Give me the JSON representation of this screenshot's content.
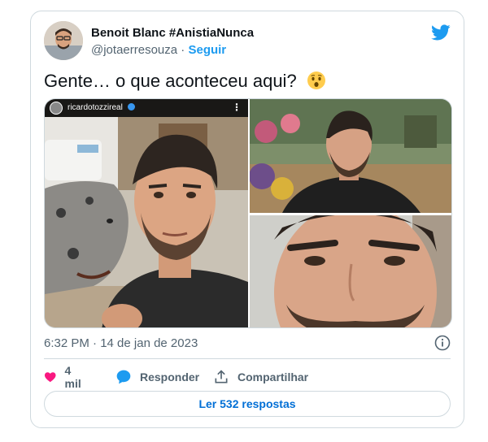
{
  "author": {
    "display_name": "Benoit Blanc #AnistiaNunca",
    "handle": "@jotaerresouza",
    "separator": "·",
    "follow_label": "Seguir"
  },
  "tweet": {
    "text": "Gente…  o que aconteceu aqui?",
    "emoji": "astonished-face-emoji",
    "timestamp": "6:32 PM · 14 de jan de 2023"
  },
  "media": {
    "instagram_username": "ricardotozzireal",
    "photos": [
      "selfie-with-dog",
      "man-in-garden",
      "face-closeup"
    ]
  },
  "actions": {
    "likes": "4 mil",
    "reply_label": "Responder",
    "share_label": "Compartilhar"
  },
  "read_replies_label": "Ler 532 respostas",
  "colors": {
    "accent": "#1d9bf0",
    "like": "#f91880",
    "text_secondary": "#536471",
    "border": "#cfd9de"
  }
}
